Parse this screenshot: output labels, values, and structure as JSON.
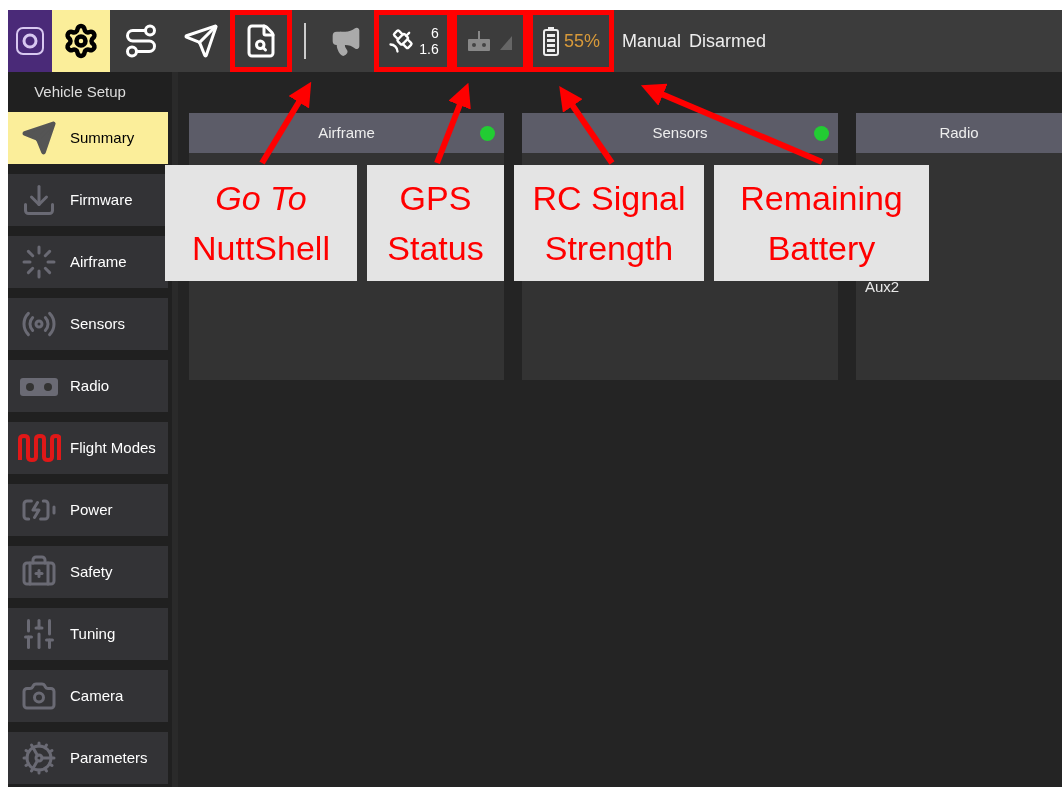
{
  "toolbar": {
    "items": [
      {
        "kind": "logo",
        "highlighted": false
      },
      {
        "kind": "setup",
        "selected": true,
        "highlighted": false
      },
      {
        "kind": "plan",
        "selected": false,
        "highlighted": false
      },
      {
        "kind": "fly",
        "selected": false,
        "highlighted": false
      },
      {
        "kind": "analyze",
        "selected": false,
        "highlighted": true
      },
      {
        "kind": "divider"
      },
      {
        "kind": "messages",
        "highlighted": false
      },
      {
        "kind": "gps",
        "highlighted": true,
        "satellites": "6",
        "hdop": "1.6"
      },
      {
        "kind": "rc",
        "highlighted": true
      },
      {
        "kind": "battery",
        "highlighted": true,
        "reading": "55%"
      },
      {
        "kind": "text",
        "label": "Manual"
      },
      {
        "kind": "text",
        "label": "Disarmed"
      }
    ]
  },
  "sidebar": {
    "title": "Vehicle Setup",
    "items": [
      {
        "kind": "summary",
        "label": "Summary",
        "selected": true
      },
      {
        "kind": "firmware",
        "label": "Firmware",
        "selected": false
      },
      {
        "kind": "airframe",
        "label": "Airframe",
        "selected": false
      },
      {
        "kind": "sensors",
        "label": "Sensors",
        "selected": false
      },
      {
        "kind": "radio",
        "label": "Radio",
        "selected": false
      },
      {
        "kind": "modes",
        "label": "Flight Modes",
        "selected": false
      },
      {
        "kind": "power",
        "label": "Power",
        "selected": false
      },
      {
        "kind": "safety",
        "label": "Safety",
        "selected": false
      },
      {
        "kind": "tuning",
        "label": "Tuning",
        "selected": false
      },
      {
        "kind": "camera",
        "label": "Camera",
        "selected": false
      },
      {
        "kind": "parameters",
        "label": "Parameters",
        "selected": false
      }
    ]
  },
  "cards": [
    {
      "title": "Airframe",
      "color": "#22cc33"
    },
    {
      "title": "Sensors",
      "color": "#22cc33"
    },
    {
      "title": "Radio",
      "rows": [
        {
          "label": "Aux2"
        }
      ]
    }
  ],
  "callouts": [
    {
      "lines": [
        "*Go To*",
        "NuttShell"
      ]
    },
    {
      "lines": [
        "GPS",
        "Status"
      ]
    },
    {
      "lines": [
        "RC Signal",
        "Strength"
      ]
    },
    {
      "lines": [
        "Remaining",
        "Battery"
      ]
    }
  ]
}
